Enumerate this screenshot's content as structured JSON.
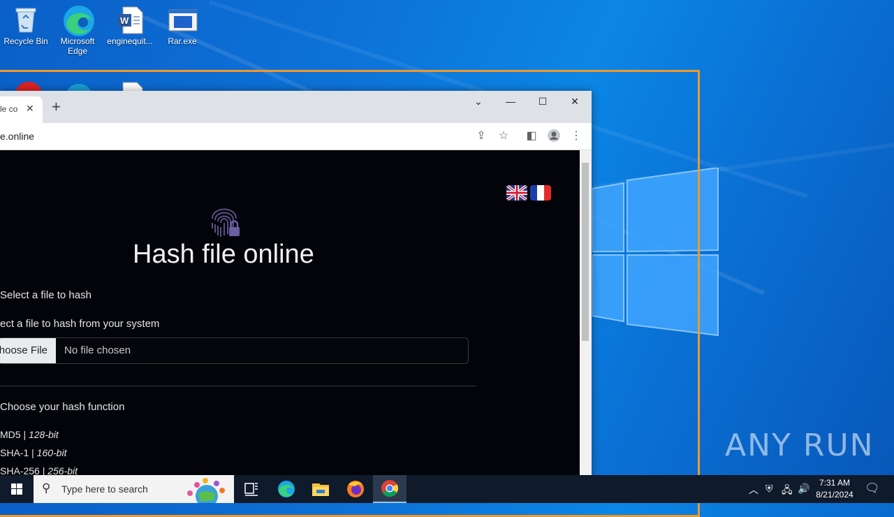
{
  "desktop": {
    "icons": [
      {
        "label": "Recycle Bin",
        "icon": "recycle-bin-icon"
      },
      {
        "label": "Microsoft Edge",
        "icon": "edge-icon"
      },
      {
        "label": "enginequit...",
        "icon": "word-doc-icon"
      },
      {
        "label": "Rar.exe",
        "icon": "exe-icon"
      }
    ],
    "watermark": "ANY RUN"
  },
  "browser": {
    "tab_title": "le co",
    "tab_close": "✕",
    "new_tab": "+",
    "url": "e.online",
    "window_controls": {
      "dropdown": "⌄",
      "minimize": "—",
      "maximize": "☐",
      "close": "✕"
    }
  },
  "page": {
    "title": "Hash file online",
    "languages": [
      "English",
      "Français"
    ],
    "select_heading": "Select a file to hash",
    "select_label": "ect a file to hash from your system",
    "choose_button": "hoose File",
    "file_status": "No file chosen",
    "hash_heading": "Choose your hash function",
    "options": [
      {
        "name": "MD5 | ",
        "bits": "128-bit"
      },
      {
        "name": "SHA-1 | ",
        "bits": "160-bit"
      },
      {
        "name": "SHA-256 | ",
        "bits": "256-bit"
      }
    ]
  },
  "taskbar": {
    "search_placeholder": "Type here to search",
    "time": "7:31 AM",
    "date": "8/21/2024"
  }
}
